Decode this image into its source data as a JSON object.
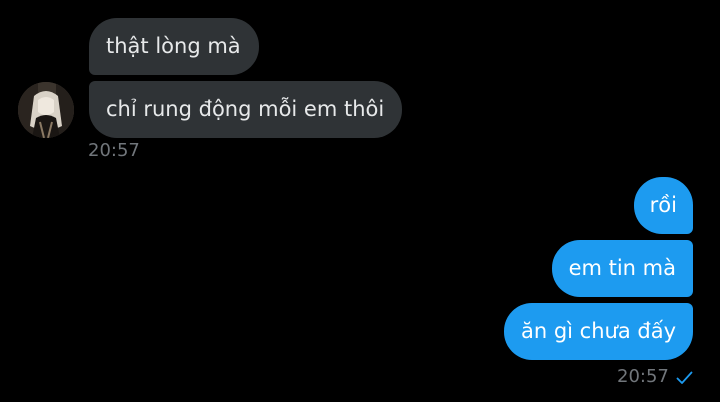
{
  "conversation": {
    "incoming": {
      "avatar_icon": "user-avatar-icon",
      "messages": [
        "thật lòng mà",
        "chỉ rung động mỗi em thôi"
      ],
      "timestamp": "20:57"
    },
    "outgoing": {
      "messages": [
        "rồi",
        "em tin mà",
        "ăn gì chưa đấy"
      ],
      "timestamp": "20:57",
      "status_icon": "checkmark-sent-icon"
    }
  },
  "colors": {
    "background": "#000000",
    "incoming_bubble": "#2f3336",
    "outgoing_bubble": "#1d9bf0",
    "timestamp": "#71767b"
  }
}
